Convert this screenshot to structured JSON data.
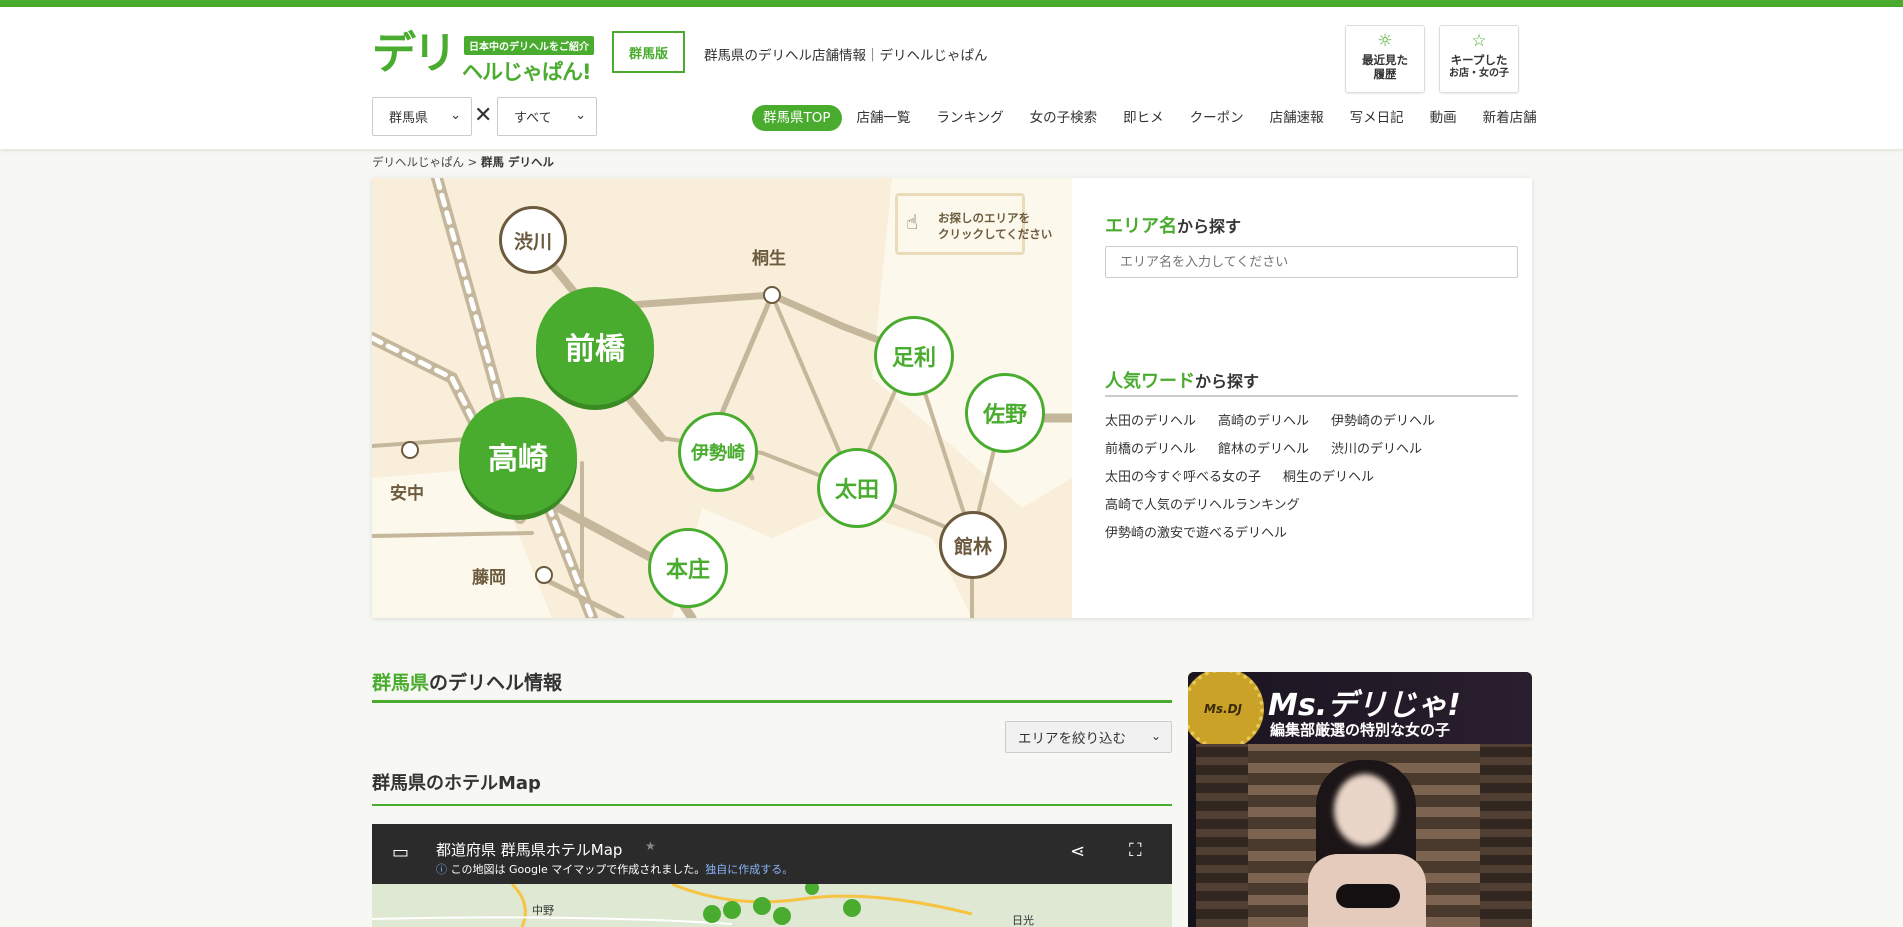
{
  "header": {
    "logo_main": "デリ",
    "logo_sub": "ヘルじゃぱん!",
    "logo_tagline": "日本中のデリヘルをご紹介",
    "edition": "群馬版",
    "site_description": "群馬県のデリヘル店舗情報｜デリヘルじゃぱん",
    "history_button": {
      "line1": "最近見た",
      "line2": "履歴",
      "icon": "sun-icon"
    },
    "keep_button": {
      "line1": "キープした",
      "line2": "お店・女の子",
      "icon": "star-icon"
    }
  },
  "filters": {
    "prefecture": "群馬県",
    "category": "すべて",
    "separator": "✕"
  },
  "nav": {
    "items": [
      "群馬県TOP",
      "店舗一覧",
      "ランキング",
      "女の子検索",
      "即ヒメ",
      "クーポン",
      "店舗速報",
      "写メ日記",
      "動画",
      "新着店舗"
    ],
    "active_index": 0
  },
  "breadcrumb": {
    "home": "デリヘルじゃぱん",
    "separator": ">",
    "current": "群馬 デリヘル"
  },
  "area_map": {
    "hint_line1": "お探しのエリアを",
    "hint_line2": "クリックしてください",
    "areas_large": [
      "前橋",
      "高崎"
    ],
    "areas_green": [
      "足利",
      "佐野",
      "伊勢崎",
      "太田",
      "本庄"
    ],
    "areas_brown": [
      "渋川",
      "館林"
    ],
    "stations": [
      "桐生",
      "安中",
      "藤岡"
    ],
    "colors": {
      "accent": "#4aac2f",
      "brown": "#6b5a3e",
      "rail": "#c5b79b",
      "map_bg": "#f8eed9"
    }
  },
  "area_search": {
    "title_highlight": "エリア名",
    "title_rest": "から探す",
    "placeholder": "エリア名を入力してください"
  },
  "popular_words": {
    "title_highlight": "人気ワード",
    "title_rest": "から探す",
    "rows": [
      [
        "太田のデリヘル",
        "高崎のデリヘル",
        "伊勢崎のデリヘル"
      ],
      [
        "前橋のデリヘル",
        "館林のデリヘル",
        "渋川のデリヘル"
      ],
      [
        "太田の今すぐ呼べる女の子",
        "桐生のデリヘル"
      ],
      [
        "高崎で人気のデリヘルランキング"
      ],
      [
        "伊勢崎の激安で遊べるデリヘル"
      ]
    ]
  },
  "info_section": {
    "title_highlight": "群馬県",
    "title_rest": "のデリヘル情報",
    "area_filter": "エリアを絞り込む"
  },
  "hotel_map": {
    "title": "群馬県のホテルMap",
    "map_title": "都道府県 群馬県ホテルMap",
    "note_prefix": "この地図は Google マイマップで作成されました。",
    "note_link": "独自に作成する。",
    "place_labels": [
      "中野",
      "日光"
    ]
  },
  "banner": {
    "brand": "Ms.デリじゃ!",
    "slogan": "編集部厳選の特別な女の子",
    "seal": "Ms.DJ"
  }
}
